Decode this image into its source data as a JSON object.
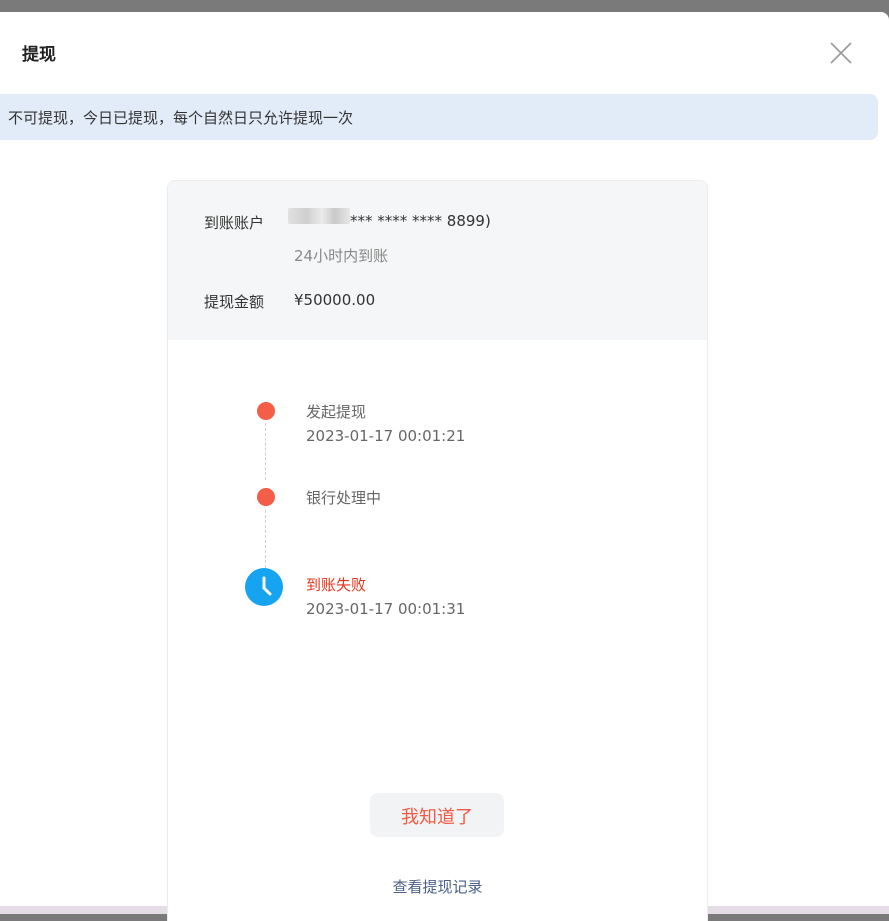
{
  "dialog": {
    "title": "提现",
    "close_icon": "close-icon"
  },
  "notice": {
    "text": "不可提现，今日已提现，每个自然日只允许提现一次"
  },
  "account": {
    "label": "到账账户",
    "masked_number": "*** **** **** 8899)",
    "arrival_hint": "24小时内到账"
  },
  "amount": {
    "label": "提现金额",
    "value": "¥50000.00"
  },
  "timeline": [
    {
      "title": "发起提现",
      "time": "2023-01-17 00:01:21",
      "status": "done",
      "color": "#f45d47"
    },
    {
      "title": "银行处理中",
      "time": "",
      "status": "done",
      "color": "#f45d47"
    },
    {
      "title": "到账失败",
      "time": "2023-01-17 00:01:31",
      "status": "failed",
      "icon": "clock-icon",
      "color": "#16a3f0"
    }
  ],
  "actions": {
    "ok_label": "我知道了",
    "records_label": "查看提现记录"
  },
  "colors": {
    "accent": "#f05a43",
    "fail_text": "#e8341c",
    "notice_bg": "#e2ecf8",
    "link": "#4b5f88"
  }
}
